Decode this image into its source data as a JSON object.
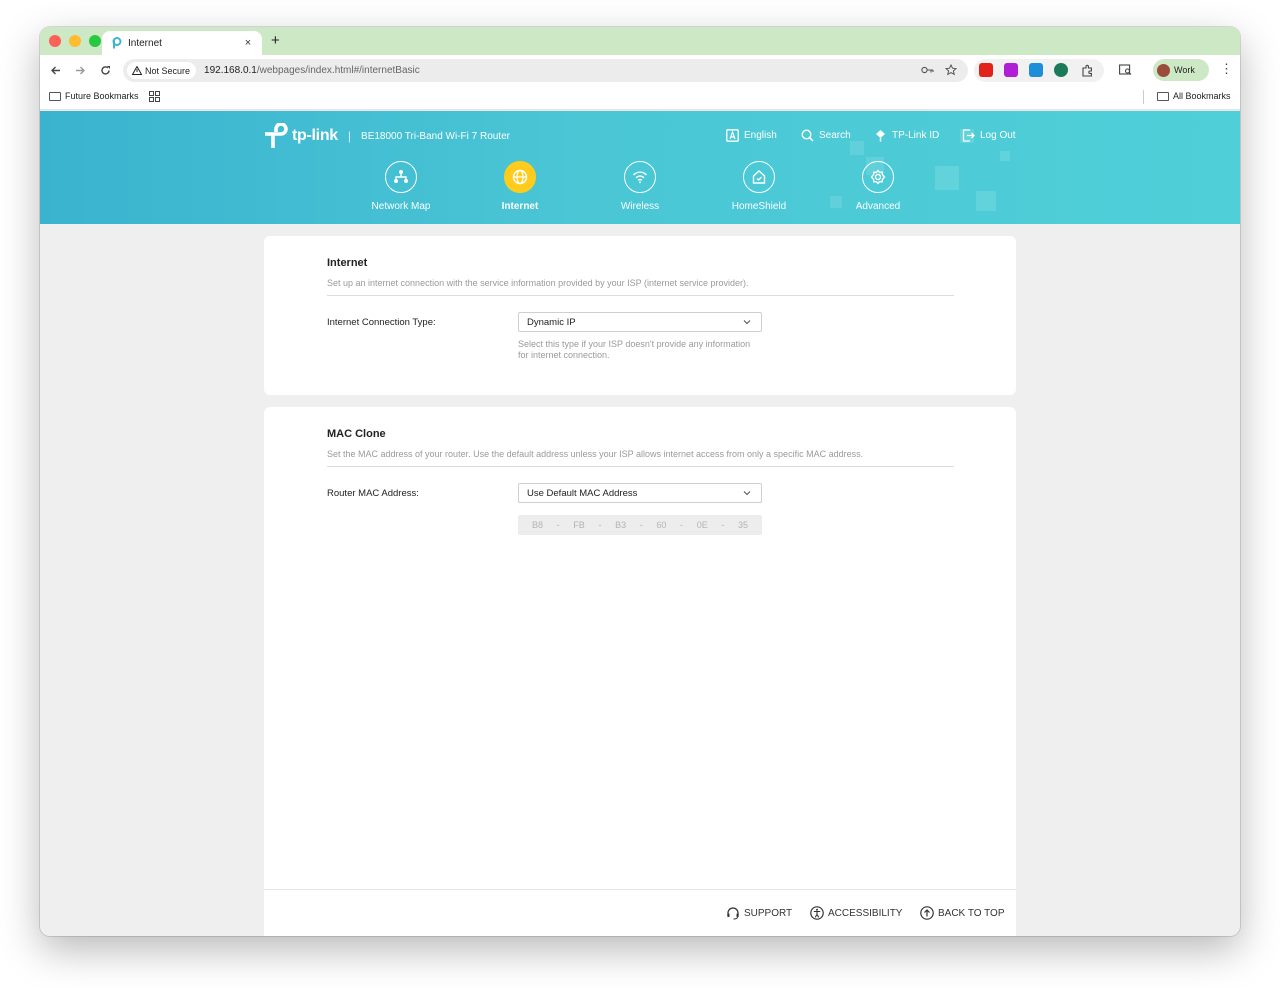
{
  "browser": {
    "tab_title": "Internet",
    "new_tab_glyph": "+",
    "close_glyph": "×",
    "security_label": "Not Secure",
    "url_host": "192.168.0.1",
    "url_path": "/webpages/index.html#/internetBasic",
    "profile_label": "Work",
    "bookmarks": {
      "left": "Future Bookmarks",
      "right": "All Bookmarks"
    }
  },
  "router": {
    "brand": "tp-link",
    "model": "BE18000 Tri-Band Wi-Fi 7 Router",
    "header_links": [
      "English",
      "Search",
      "TP-Link ID",
      "Log Out"
    ],
    "nav": [
      "Network Map",
      "Internet",
      "Wireless",
      "HomeShield",
      "Advanced"
    ],
    "active_nav": "Internet"
  },
  "internet_card": {
    "title": "Internet",
    "description": "Set up an internet connection with the service information provided by your ISP (internet service provider).",
    "field_label": "Internet Connection Type:",
    "selected": "Dynamic IP",
    "hint": "Select this type if your ISP doesn't provide any information for internet connection."
  },
  "mac_card": {
    "title": "MAC Clone",
    "description": "Set the MAC address of your router. Use the default address unless your ISP allows internet access from only a specific MAC address.",
    "field_label": "Router MAC Address:",
    "selected": "Use Default MAC Address",
    "mac_octets": [
      "B8",
      "FB",
      "B3",
      "60",
      "0E",
      "35"
    ],
    "separator": "-"
  },
  "footer": {
    "support": "SUPPORT",
    "accessibility": "ACCESSIBILITY",
    "back_to_top": "BACK TO TOP"
  },
  "colors": {
    "header_teal": "#4ac6d5",
    "active_nav": "#ffcc1d",
    "tab_strip": "#cde8c4"
  }
}
